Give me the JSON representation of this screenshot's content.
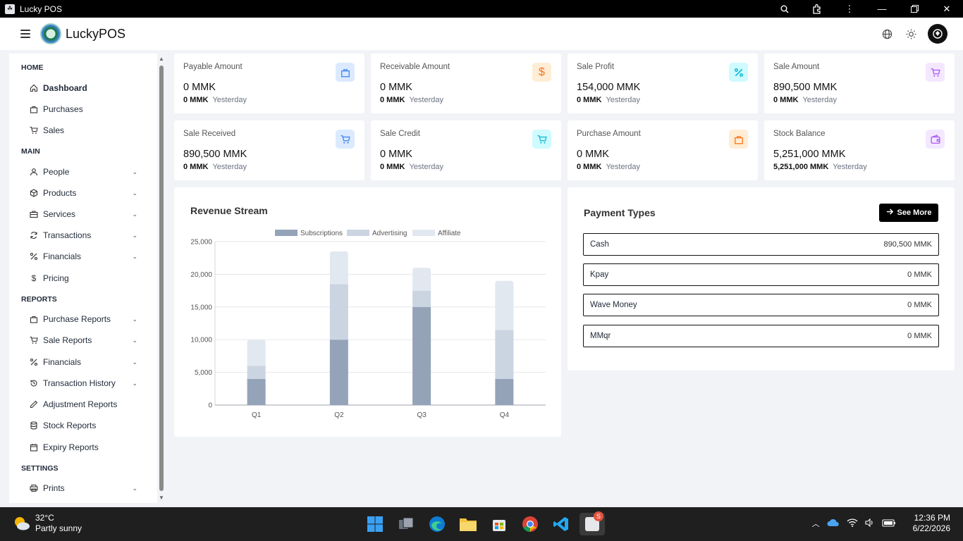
{
  "window": {
    "title": "Lucky POS"
  },
  "header": {
    "brand": "LuckyPOS"
  },
  "sidebar": {
    "sections": [
      {
        "label": "HOME"
      },
      {
        "label": "MAIN"
      },
      {
        "label": "REPORTS"
      },
      {
        "label": "SETTINGS"
      }
    ],
    "items": [
      {
        "label": "Dashboard",
        "icon": "home-icon"
      },
      {
        "label": "Purchases",
        "icon": "bag-icon"
      },
      {
        "label": "Sales",
        "icon": "cart-icon"
      },
      {
        "label": "People",
        "icon": "user-icon"
      },
      {
        "label": "Products",
        "icon": "box-icon"
      },
      {
        "label": "Services",
        "icon": "briefcase-icon"
      },
      {
        "label": "Transactions",
        "icon": "refresh-icon"
      },
      {
        "label": "Financials",
        "icon": "percent-icon"
      },
      {
        "label": "Pricing",
        "icon": "dollar-icon"
      },
      {
        "label": "Purchase Reports",
        "icon": "bag-icon"
      },
      {
        "label": "Sale Reports",
        "icon": "cart-icon"
      },
      {
        "label": "Financials",
        "icon": "percent-icon"
      },
      {
        "label": "Transaction History",
        "icon": "history-icon"
      },
      {
        "label": "Adjustment Reports",
        "icon": "pencil-icon"
      },
      {
        "label": "Stock Reports",
        "icon": "database-icon"
      },
      {
        "label": "Expiry Reports",
        "icon": "calendar-icon"
      },
      {
        "label": "Prints",
        "icon": "printer-icon"
      }
    ]
  },
  "stats": [
    {
      "label": "Payable Amount",
      "value": "0 MMK",
      "sub_value": "0 MMK",
      "sub_label": "Yesterday",
      "icon": "bag-icon",
      "color": "#3b82f6",
      "bg": "#dbeafe"
    },
    {
      "label": "Receivable Amount",
      "value": "0 MMK",
      "sub_value": "0 MMK",
      "sub_label": "Yesterday",
      "icon": "dollar-icon",
      "color": "#f97316",
      "bg": "#ffedd5"
    },
    {
      "label": "Sale Profit",
      "value": "154,000 MMK",
      "sub_value": "0 MMK",
      "sub_label": "Yesterday",
      "icon": "percent-icon",
      "color": "#06b6d4",
      "bg": "#cffafe"
    },
    {
      "label": "Sale Amount",
      "value": "890,500 MMK",
      "sub_value": "0 MMK",
      "sub_label": "Yesterday",
      "icon": "cart-icon",
      "color": "#a855f7",
      "bg": "#f3e8ff"
    },
    {
      "label": "Sale Received",
      "value": "890,500 MMK",
      "sub_value": "0 MMK",
      "sub_label": "Yesterday",
      "icon": "cart-icon",
      "color": "#3b82f6",
      "bg": "#dbeafe"
    },
    {
      "label": "Sale Credit",
      "value": "0 MMK",
      "sub_value": "0 MMK",
      "sub_label": "Yesterday",
      "icon": "cart-icon",
      "color": "#06b6d4",
      "bg": "#cffafe"
    },
    {
      "label": "Purchase Amount",
      "value": "0 MMK",
      "sub_value": "0 MMK",
      "sub_label": "Yesterday",
      "icon": "bag-icon",
      "color": "#f97316",
      "bg": "#ffedd5"
    },
    {
      "label": "Stock Balance",
      "value": "5,251,000 MMK",
      "sub_value": "5,251,000 MMK",
      "sub_label": "Yesterday",
      "icon": "wallet-icon",
      "color": "#a855f7",
      "bg": "#f3e8ff"
    }
  ],
  "revenue": {
    "title": "Revenue Stream"
  },
  "chart_data": {
    "type": "bar",
    "stacked": true,
    "categories": [
      "Q1",
      "Q2",
      "Q3",
      "Q4"
    ],
    "series": [
      {
        "name": "Subscriptions",
        "values": [
          4000,
          10000,
          15000,
          4000
        ],
        "color": "#94a3b8"
      },
      {
        "name": "Advertising",
        "values": [
          2000,
          8500,
          2500,
          7500
        ],
        "color": "#cbd5e1"
      },
      {
        "name": "Affiliate",
        "values": [
          4000,
          5000,
          3500,
          7500
        ],
        "color": "#e2e8f0"
      }
    ],
    "ylim": [
      0,
      25000
    ],
    "yticks": [
      "0",
      "5,000",
      "10,000",
      "15,000",
      "20,000",
      "25,000"
    ],
    "grid": true,
    "legend": "top"
  },
  "payments": {
    "title": "Payment Types",
    "see_more": "See More",
    "rows": [
      {
        "name": "Cash",
        "value": "890,500 MMK"
      },
      {
        "name": "Kpay",
        "value": "0 MMK"
      },
      {
        "name": "Wave Money",
        "value": "0 MMK"
      },
      {
        "name": "MMqr",
        "value": "0 MMK"
      }
    ]
  },
  "taskbar": {
    "temp": "32°C",
    "weather": "Partly sunny",
    "time": "12:36 PM",
    "date": "6/22/2026",
    "badge": "S"
  }
}
